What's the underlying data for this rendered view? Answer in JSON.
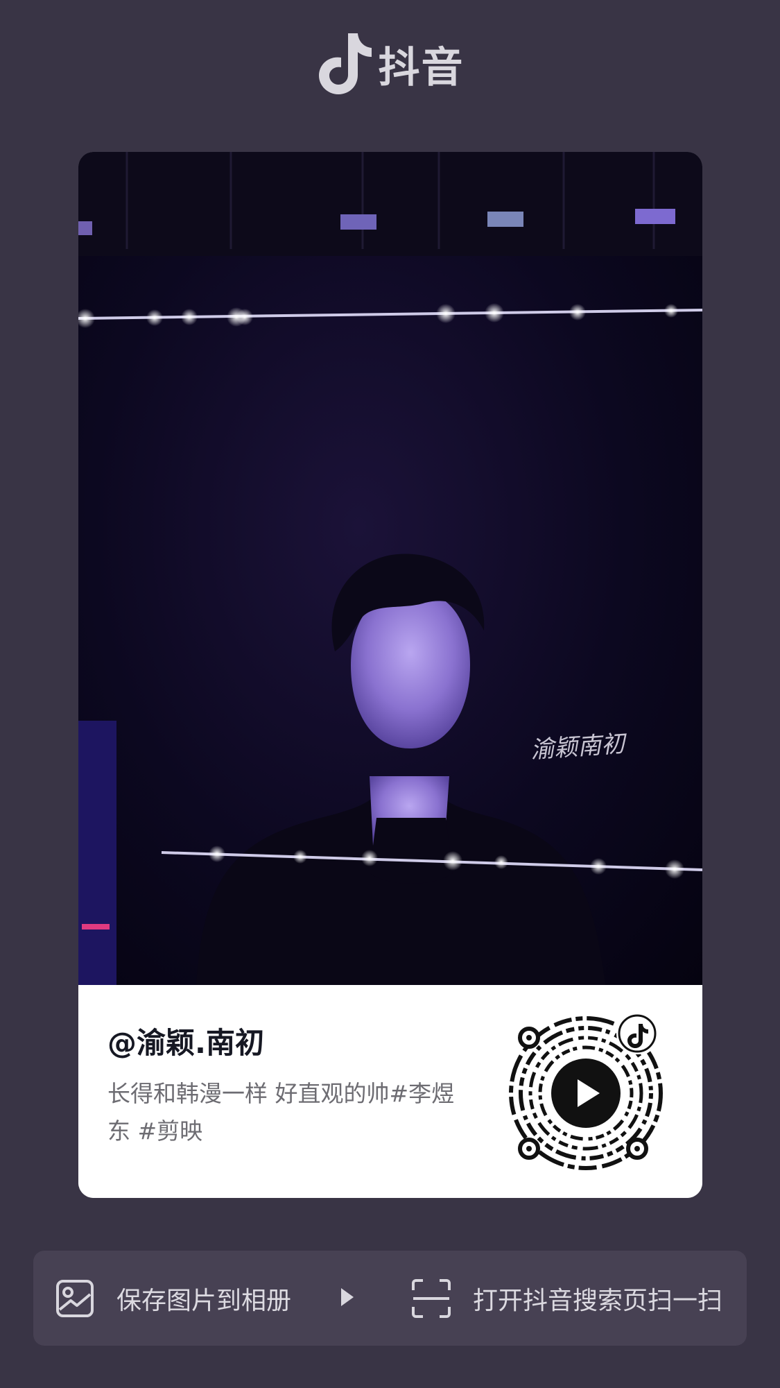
{
  "brand": {
    "name": "抖音",
    "icon": "tiktok-note-icon"
  },
  "card": {
    "cover_watermark": "渝颖南初",
    "author": "@渝颖.南初",
    "description": "长得和韩漫一样 好直观的帅#李煜东 #剪映",
    "qr_icon": "qr-code-icon"
  },
  "actions": {
    "save": {
      "label": "保存图片到相册",
      "icon": "image-icon"
    },
    "scan": {
      "label": "打开抖音搜索页扫一扫",
      "icon": "scan-icon"
    }
  },
  "colors": {
    "background": "#393445",
    "action_bar": "#474153",
    "card_info_bg": "#ffffff",
    "author_text": "#161823",
    "desc_text": "#6d6c72"
  }
}
